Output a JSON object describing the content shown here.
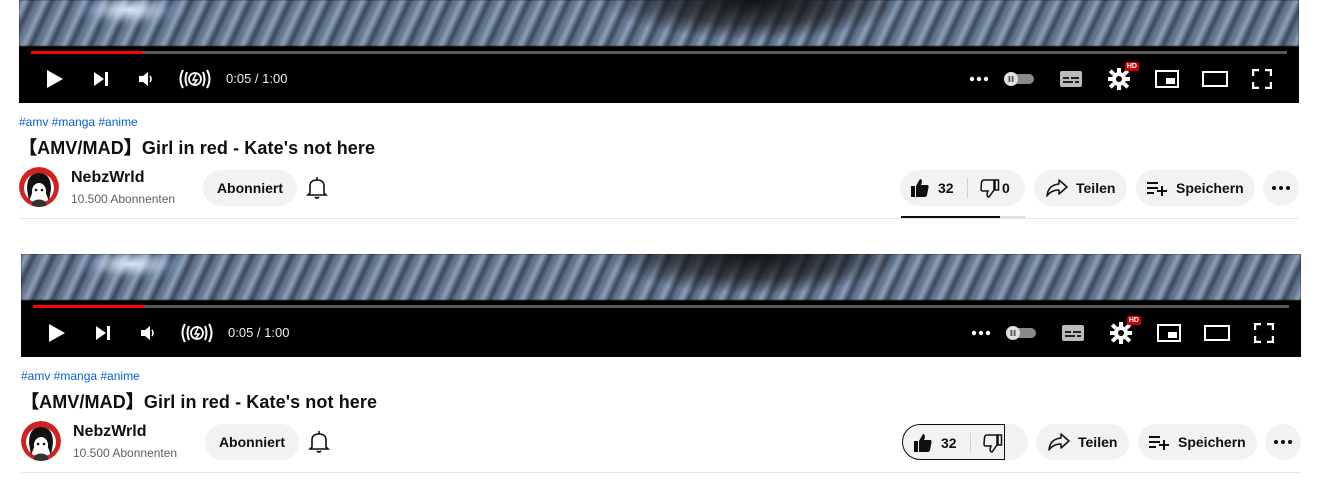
{
  "player": {
    "time": "0:05 / 1:00",
    "hd_badge": "HD",
    "progress_fraction": 0.088
  },
  "video": {
    "tags": "#amv #manga #anime",
    "title": "【AMV/MAD】Girl in red - Kate's not here"
  },
  "channel": {
    "name": "NebzWrld",
    "subscribers": "10.500 Abonnenten",
    "subscribe_label": "Abonniert"
  },
  "actions": {
    "likes": "32",
    "dislikes": "0",
    "share_label": "Teilen",
    "save_label": "Speichern"
  },
  "colors": {
    "progress": "#ff0000",
    "link": "#065fd4",
    "pill_bg": "#f2f2f2"
  },
  "icons": [
    "play-icon",
    "next-icon",
    "volume-icon",
    "stable-volume-icon",
    "more-icon",
    "autoplay-toggle-icon",
    "subtitles-icon",
    "settings-icon",
    "miniplayer-icon",
    "theater-icon",
    "fullscreen-icon",
    "bell-icon",
    "thumbs-up-icon",
    "thumbs-down-icon",
    "share-icon",
    "save-icon",
    "more-horizontal-icon"
  ]
}
